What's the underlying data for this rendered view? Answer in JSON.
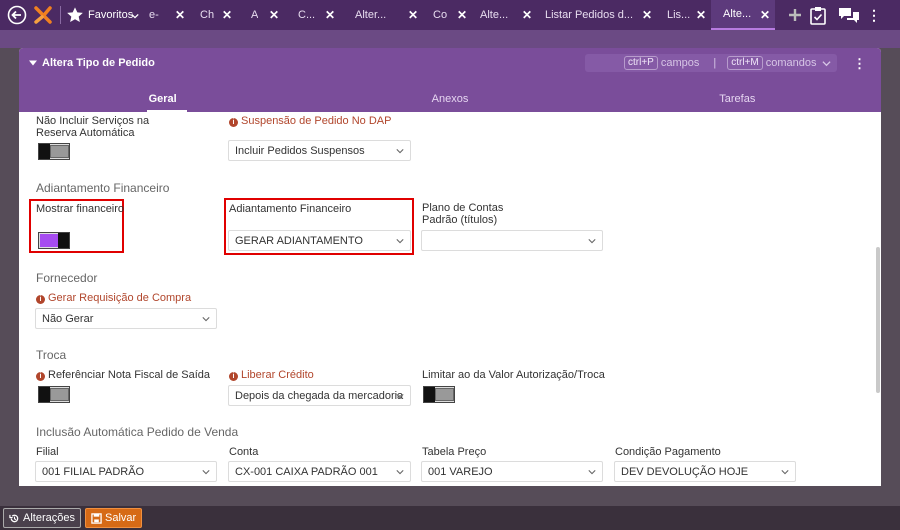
{
  "topbar": {
    "favorites_label": "Favoritos",
    "tabs": [
      {
        "label": "e-"
      },
      {
        "label": "Ch"
      },
      {
        "label": "A"
      },
      {
        "label": "C..."
      },
      {
        "label": "Alter..."
      },
      {
        "label": "Co"
      },
      {
        "label": "Alte..."
      },
      {
        "label": "Listar Pedidos d..."
      },
      {
        "label": "Lis..."
      },
      {
        "label": "Alte..."
      }
    ]
  },
  "window": {
    "title": "Altera Tipo de Pedido",
    "cmd_key1": "ctrl+P",
    "cmd_text1": "campos",
    "cmd_sep": "|",
    "cmd_key2": "ctrl+M",
    "cmd_text2": "comandos",
    "tabs": [
      "Geral",
      "Anexos",
      "Tarefas"
    ]
  },
  "form": {
    "nao_incluir_label": "Não Incluir Serviços na Reserva Automática",
    "suspensao_label": "Suspensão de Pedido No DAP",
    "suspensao_value": "Incluir Pedidos Suspensos",
    "adiantamento_section": "Adiantamento Financeiro",
    "mostrar_financeiro_label": "Mostrar financeiro",
    "adiantamento_label": "Adiantamento Financeiro",
    "adiantamento_value": "GERAR ADIANTAMENTO",
    "plano_contas_label": "Plano de Contas Padrão (títulos)",
    "plano_contas_value": "",
    "fornecedor_section": "Fornecedor",
    "gerar_requisicao_label": "Gerar Requisição de Compra",
    "gerar_requisicao_value": "Não Gerar",
    "troca_section": "Troca",
    "referenciar_label": "Referênciar Nota Fiscal de Saída",
    "liberar_credito_label": "Liberar Crédito",
    "liberar_credito_value": "Depois da chegada da mercadoria",
    "limitar_label": "Limitar ao da Valor Autorização/Troca",
    "inclusao_section": "Inclusão Automática Pedido de Venda",
    "filial_label": "Filial",
    "filial_value": "001 FILIAL PADRÃO",
    "conta_label": "Conta",
    "conta_value": "CX-001 CAIXA PADRÃO 001",
    "tabela_label": "Tabela Preço",
    "tabela_value": "001 VAREJO",
    "condicao_label": "Condição Pagamento",
    "condicao_value": "DEV DEVOLUÇÃO HOJE"
  },
  "bottombar": {
    "alteracoes_label": "Alterações",
    "salvar_label": "Salvar"
  },
  "colors": {
    "topbar": "#4b2a63",
    "header": "#7a4d9a",
    "accent_toggle": "#a64cf0",
    "highlight": "#e00000",
    "save_button": "#d66a16"
  }
}
